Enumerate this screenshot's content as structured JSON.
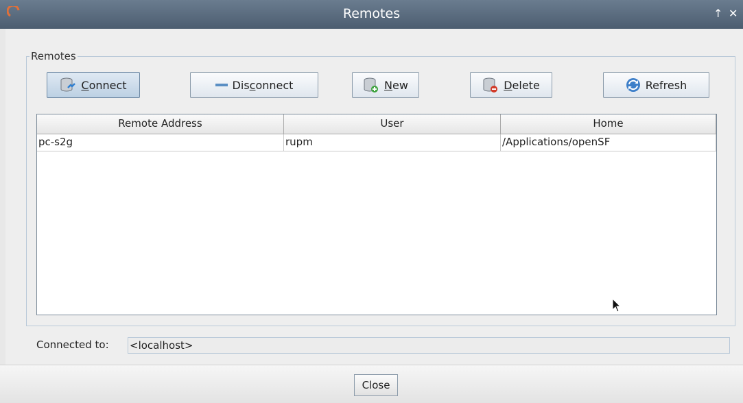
{
  "window": {
    "title": "Remotes",
    "icons": [
      "app-swirl-icon",
      "arrow-up-icon",
      "close-icon"
    ],
    "titlebar_color": "#566779"
  },
  "group": {
    "legend": "Remotes"
  },
  "toolbar": {
    "connect": {
      "pre": "",
      "mnemonic": "C",
      "post": "onnect",
      "icon": "database-connect-icon"
    },
    "disconnect": {
      "pre": "Dis",
      "mnemonic": "c",
      "post": "onnect",
      "icon": "minus-icon"
    },
    "new": {
      "pre": "",
      "mnemonic": "N",
      "post": "ew",
      "icon": "database-add-icon"
    },
    "delete": {
      "pre": "",
      "mnemonic": "D",
      "post": "elete",
      "icon": "database-delete-icon"
    },
    "refresh": {
      "label": "Refresh",
      "icon": "refresh-icon"
    }
  },
  "table": {
    "columns": [
      "Remote Address",
      "User",
      "Home"
    ],
    "rows": [
      {
        "address": "pc-s2g",
        "user": "rupm",
        "home": "/Applications/openSF"
      }
    ]
  },
  "status": {
    "label": "Connected to:",
    "value": "<localhost>"
  },
  "footer": {
    "close_label": "Close"
  }
}
